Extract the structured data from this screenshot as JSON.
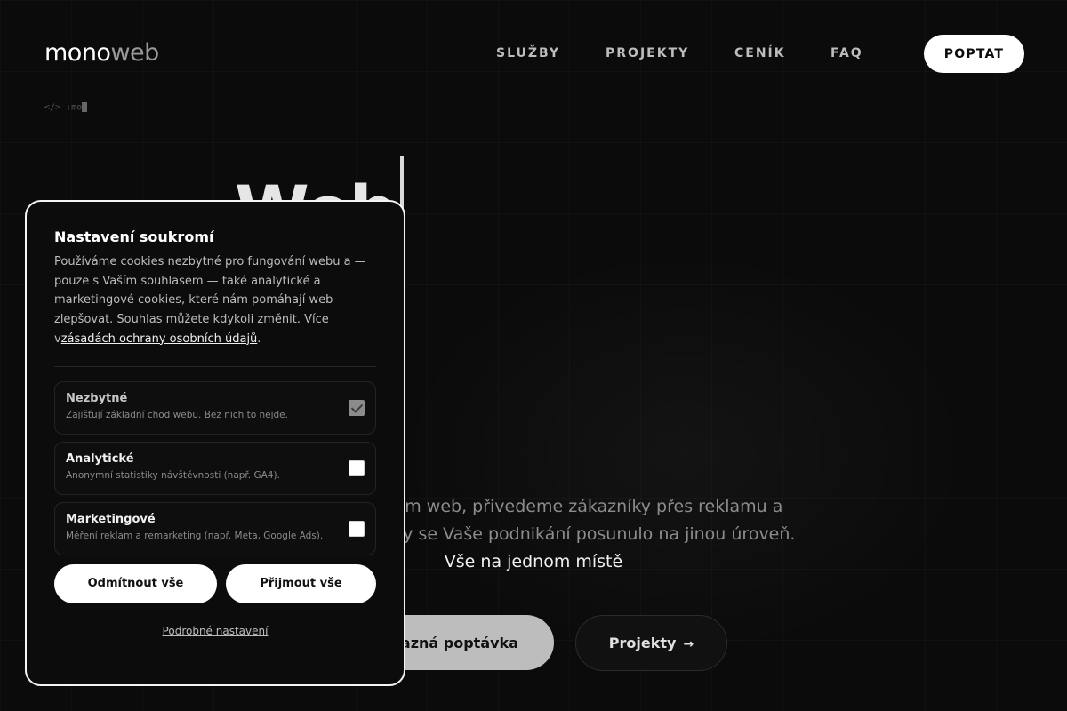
{
  "brand": {
    "logo_part1": "mono",
    "logo_part2": "web"
  },
  "nav": {
    "items": [
      {
        "label": "SLUŽBY"
      },
      {
        "label": "PROJEKTY"
      },
      {
        "label": "CENÍK"
      },
      {
        "label": "FAQ"
      }
    ],
    "cta_label": "POPTAT"
  },
  "terminal": {
    "text": "</> :mo"
  },
  "hero": {
    "title": "Web",
    "line1": "ám web, přivedeme zákazníky přes reklamu a",
    "line2": "aby se Vaše podnikání posunulo na jinou úroveň.",
    "line3": "Vše na jednom místě",
    "primary_label": "ávazná poptávka",
    "secondary_label": "Projekty",
    "secondary_icon": "arrow-right-icon"
  },
  "cookies": {
    "title": "Nastavení soukromí",
    "desc_before_link": "Používáme cookies nezbytné pro fungování webu a — pouze s Vaším souhlasem — také analytické a marketingové cookies, které nám pomáhají web zlepšovat. Souhlas můžete kdykoli změnit. Více v",
    "link_text": "zásadách ochrany osobních údajů",
    "desc_after_link": ".",
    "options": [
      {
        "title": "Nezbytné",
        "subtitle": "Zajišťují základní chod webu. Bez nich to nejde.",
        "checked": true,
        "disabled": true
      },
      {
        "title": "Analytické",
        "subtitle": "Anonymní statistiky návštěvnosti (např. GA4).",
        "checked": false,
        "disabled": false
      },
      {
        "title": "Marketingové",
        "subtitle": "Měření reklam a remarketing (např. Meta, Google Ads).",
        "checked": false,
        "disabled": false
      }
    ],
    "reject_label": "Odmítnout vše",
    "accept_label": "Přijmout vše",
    "details_label": "Podrobné nastavení"
  }
}
